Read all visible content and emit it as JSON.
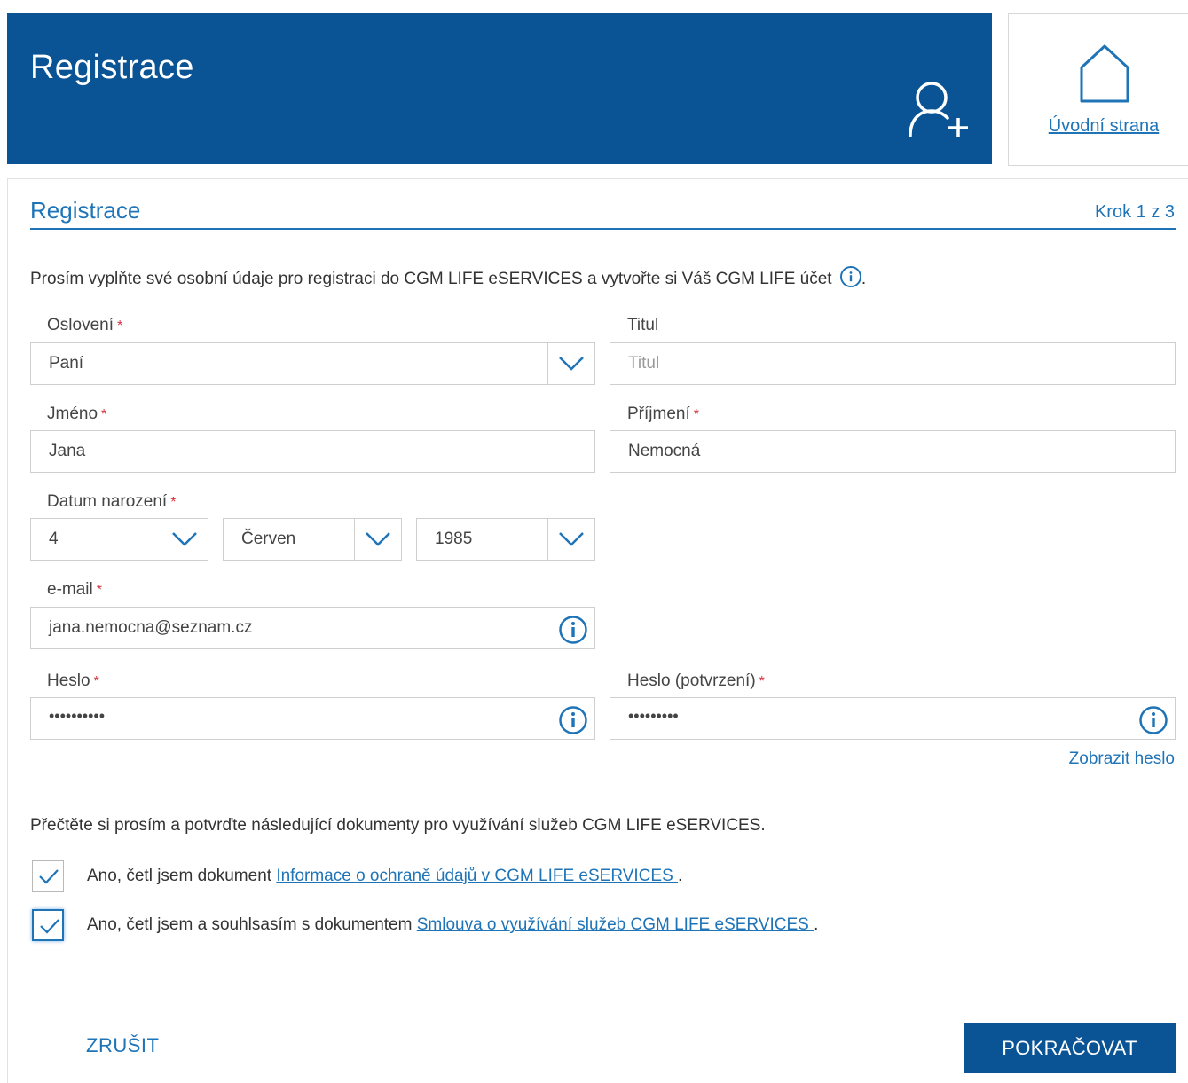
{
  "header": {
    "title": "Registrace",
    "home_link": "Úvodní strana",
    "brand_color": "#0a5394"
  },
  "section": {
    "title": "Registrace",
    "step": "Krok 1 z 3"
  },
  "intro_text": "Prosím vyplňte své osobní údaje pro registraci do CGM LIFE eSERVICES a vytvořte si Váš CGM LIFE účet",
  "intro_tail": ".",
  "form": {
    "salutation": {
      "label": "Oslovení",
      "value": "Paní"
    },
    "title": {
      "label": "Titul",
      "placeholder": "Titul"
    },
    "first_name": {
      "label": "Jméno",
      "value": "Jana"
    },
    "last_name": {
      "label": "Příjmení",
      "value": "Nemocná"
    },
    "birth_date": {
      "label": "Datum narození",
      "day": "4",
      "month": "Červen",
      "year": "1985"
    },
    "email": {
      "label": "e-mail",
      "value": "jana.nemocna@seznam.cz"
    },
    "password": {
      "label": "Heslo",
      "value": "••••••••••"
    },
    "password_confirm": {
      "label": "Heslo (potvrzení)",
      "value": "•••••••••"
    },
    "required_mark": "*",
    "show_password": "Zobrazit heslo"
  },
  "documents": {
    "intro": "Přečtěte si prosím a potvrďte následující dokumenty pro využívání služeb CGM LIFE eSERVICES.",
    "items": [
      {
        "prefix": "Ano, četl jsem dokument ",
        "link": "Informace o ochraně údajů v CGM LIFE eSERVICES ",
        "suffix": ".",
        "checked": true
      },
      {
        "prefix": "Ano, četl jsem a souhlsasím s dokumentem ",
        "link": "Smlouva o využívání služeb CGM LIFE eSERVICES ",
        "suffix": ".",
        "checked": true
      }
    ]
  },
  "actions": {
    "cancel": "ZRUŠIT",
    "continue": "POKRAČOVAT"
  },
  "icons": {
    "user_add": "user-add-icon",
    "home": "home-icon",
    "info": "info-icon",
    "dropdown": "chevron-down-icon",
    "check": "check-icon"
  }
}
